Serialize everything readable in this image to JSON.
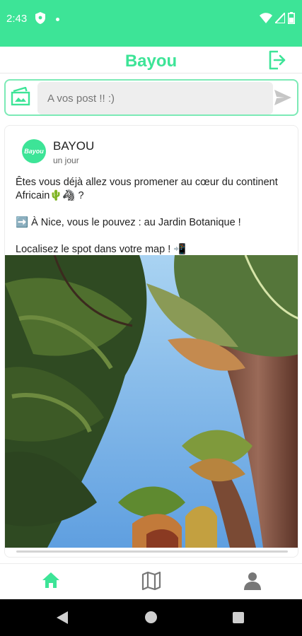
{
  "status_bar": {
    "time": "2:43"
  },
  "app_bar": {
    "title": "Bayou"
  },
  "composer": {
    "placeholder": "A vos post !! :)"
  },
  "post": {
    "avatar_text": "Bayou",
    "author": "BAYOU",
    "time": "un jour",
    "paragraphs": [
      "Êtes vous déjà allez vous promener au cœur du continent Africain🌵🦓 ?",
      "➡️ À Nice, vous le pouvez : au Jardin Botanique !",
      "Localisez le spot dans votre map ! 📲"
    ]
  },
  "bottom_nav": {
    "items": [
      {
        "name": "home",
        "icon": "home-icon",
        "active": true
      },
      {
        "name": "map",
        "icon": "map-icon",
        "active": false
      },
      {
        "name": "profile",
        "icon": "person-icon",
        "active": false
      }
    ]
  },
  "colors": {
    "accent": "#3de497",
    "inactive_icon": "#777777"
  }
}
